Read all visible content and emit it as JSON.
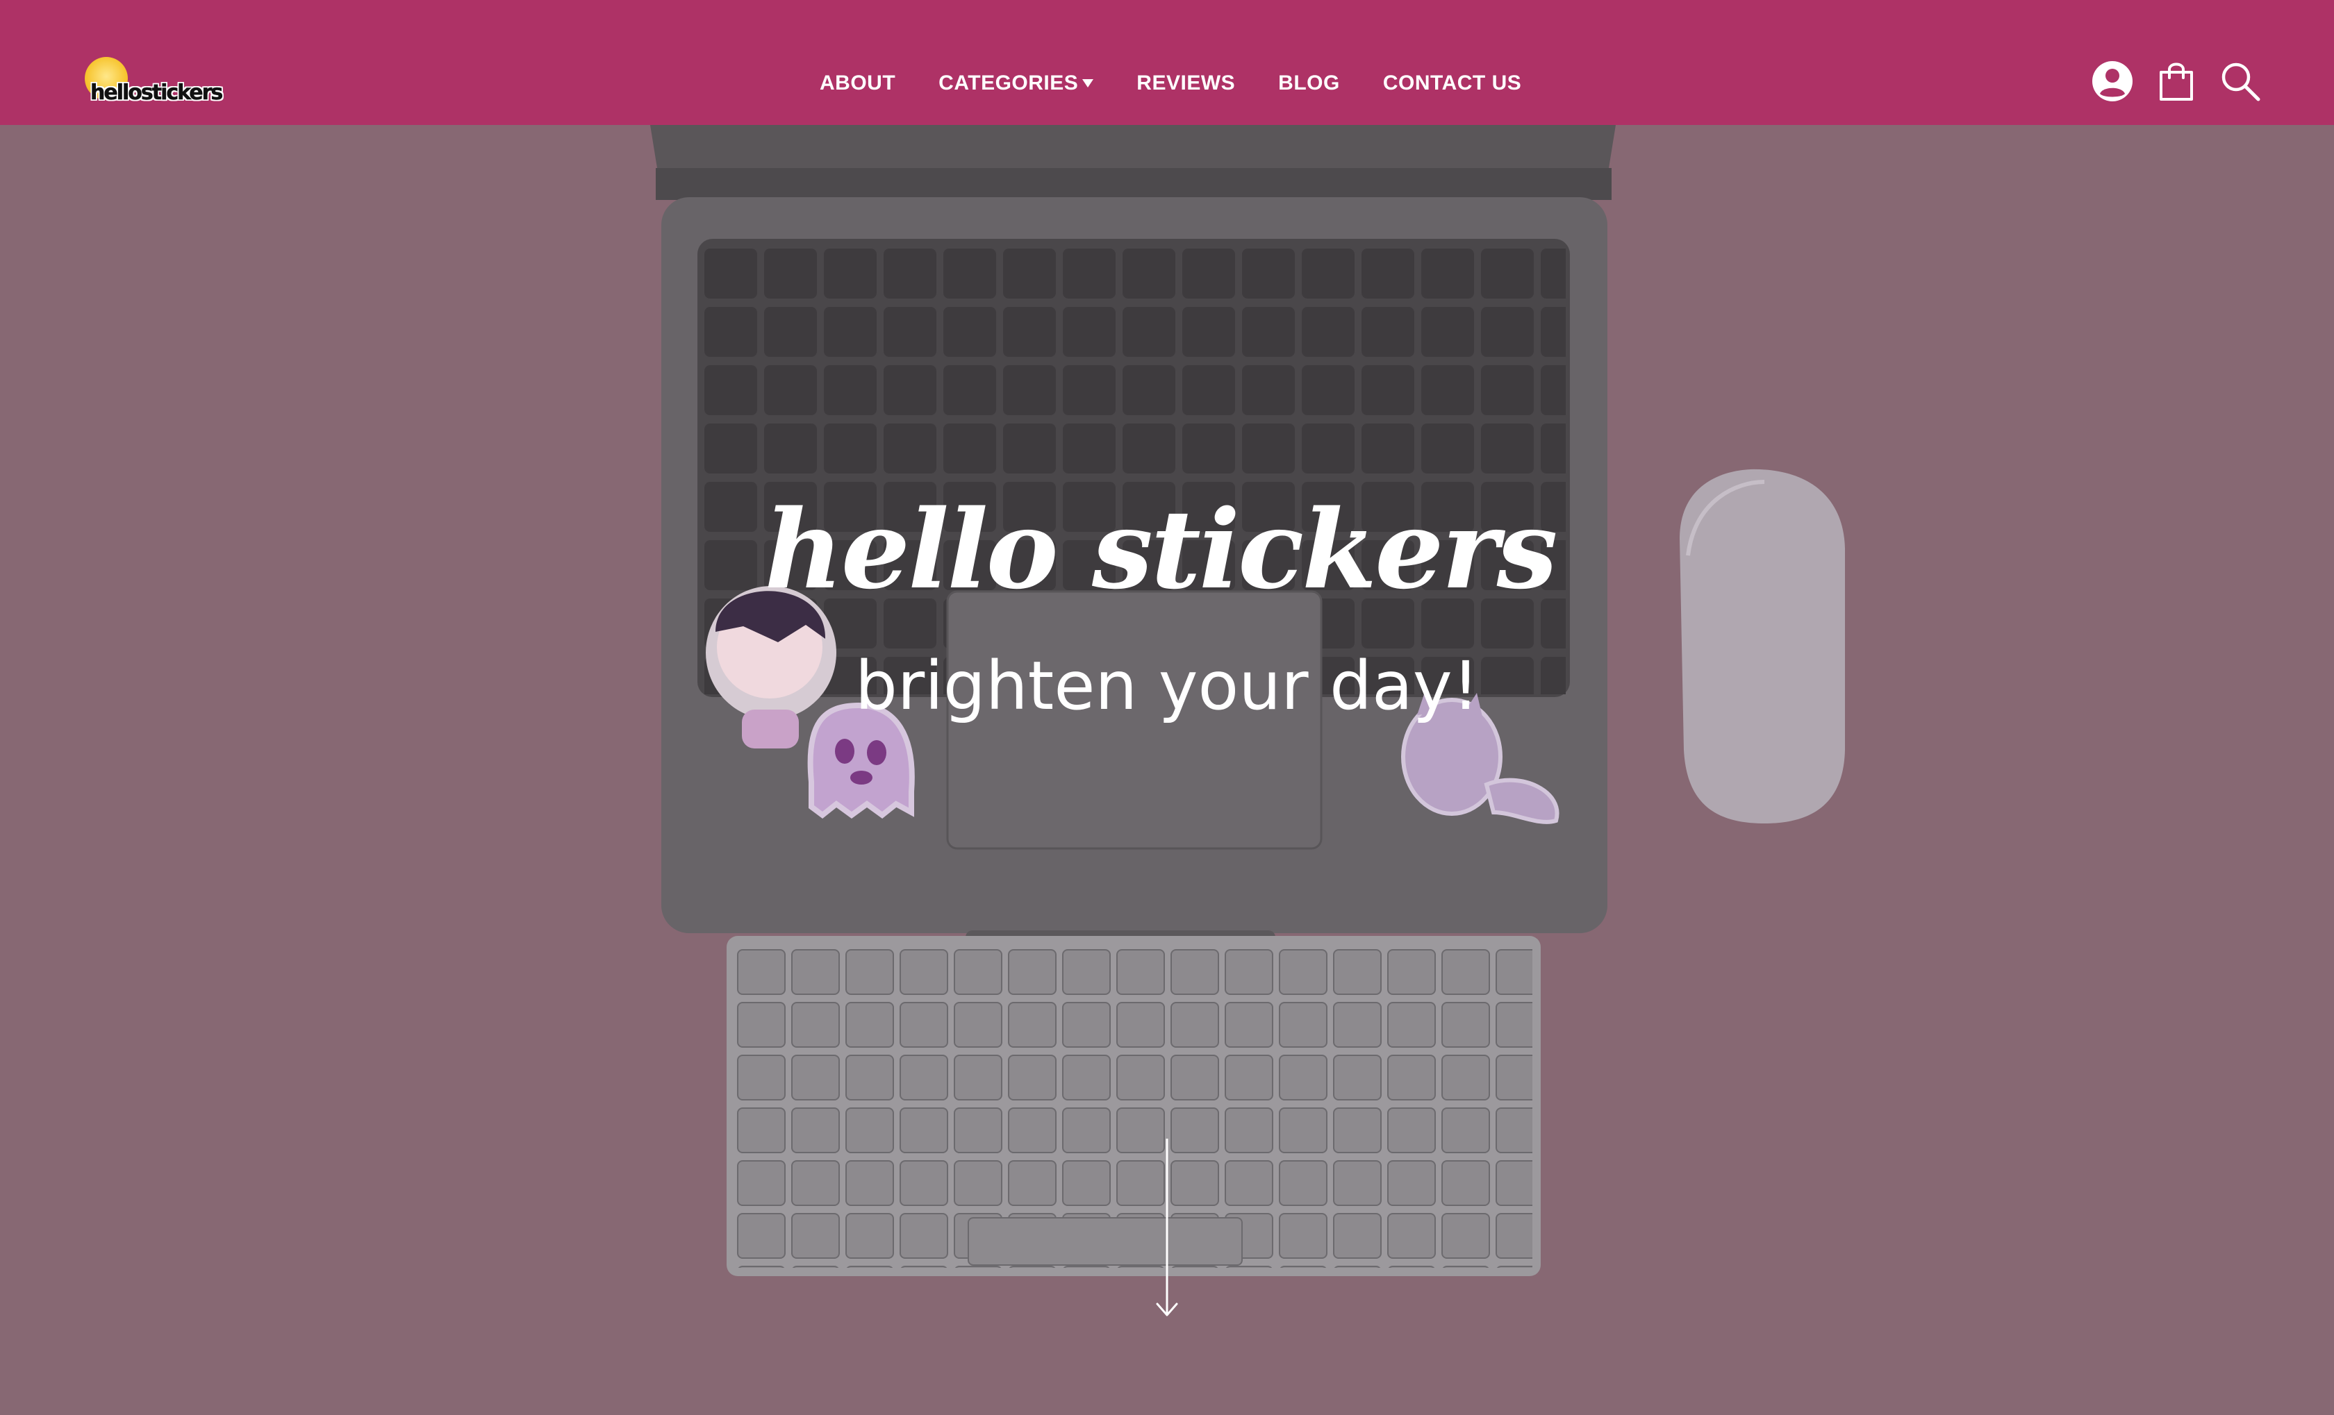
{
  "header": {
    "logo_text": "hellostickers",
    "nav": [
      {
        "label": "ABOUT"
      },
      {
        "label": "CATEGORIES"
      },
      {
        "label": "REVIEWS"
      },
      {
        "label": "BLOG"
      },
      {
        "label": "CONTACT US"
      }
    ],
    "icons": [
      "account-icon",
      "shopping-bag-icon",
      "search-icon"
    ]
  },
  "hero": {
    "title": "hello stickers",
    "subtitle": "brighten your day!",
    "scroll_icon": "arrow-down-icon"
  },
  "colors": {
    "header_bg": "#ae3266",
    "hero_overlay": "#8a6a74",
    "text": "#ffffff"
  }
}
